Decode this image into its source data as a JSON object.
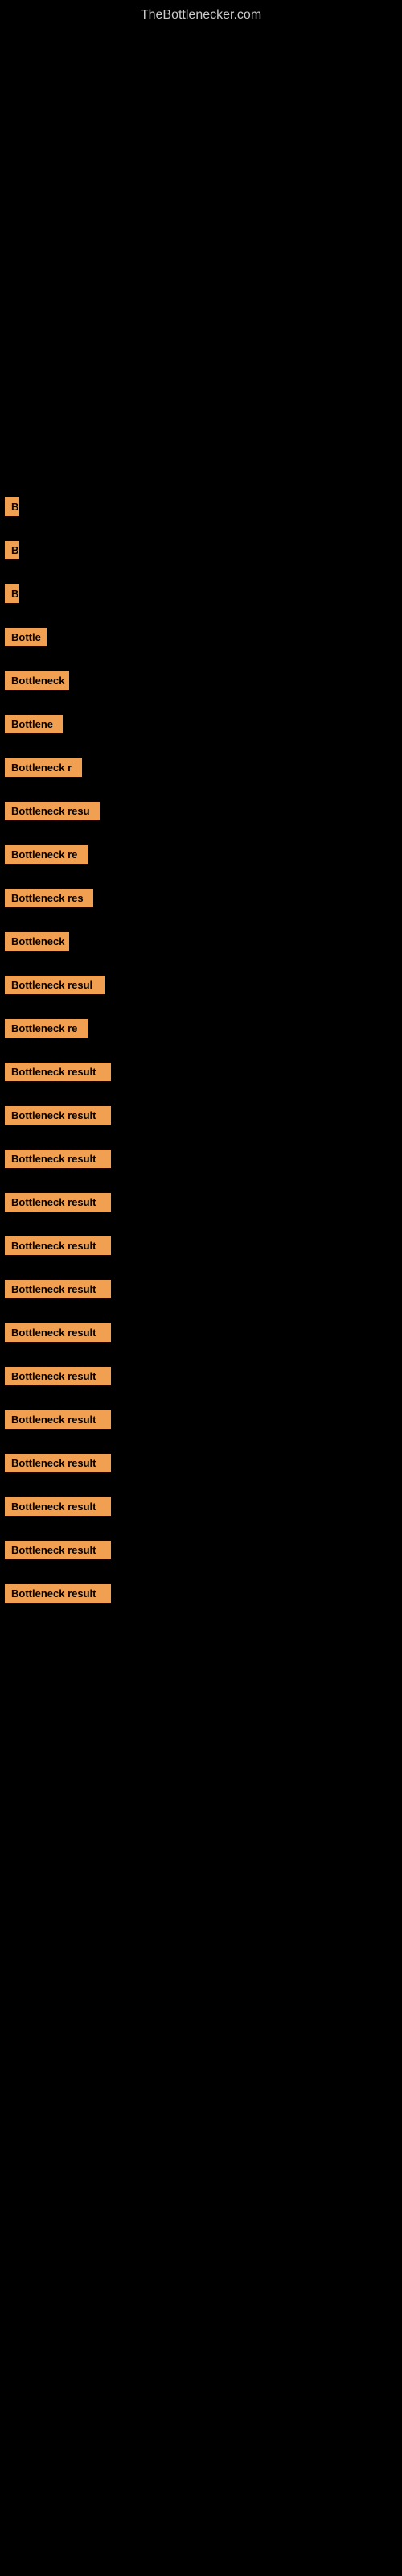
{
  "site": {
    "title": "TheBottlenecker.com"
  },
  "bars": [
    {
      "id": 1,
      "label": "B",
      "width": 18
    },
    {
      "id": 2,
      "label": "B",
      "width": 18
    },
    {
      "id": 3,
      "label": "B",
      "width": 18
    },
    {
      "id": 4,
      "label": "Bottle",
      "width": 52
    },
    {
      "id": 5,
      "label": "Bottleneck",
      "width": 80
    },
    {
      "id": 6,
      "label": "Bottlene",
      "width": 72
    },
    {
      "id": 7,
      "label": "Bottleneck r",
      "width": 96
    },
    {
      "id": 8,
      "label": "Bottleneck resu",
      "width": 118
    },
    {
      "id": 9,
      "label": "Bottleneck re",
      "width": 104
    },
    {
      "id": 10,
      "label": "Bottleneck res",
      "width": 110
    },
    {
      "id": 11,
      "label": "Bottleneck",
      "width": 80
    },
    {
      "id": 12,
      "label": "Bottleneck resul",
      "width": 124
    },
    {
      "id": 13,
      "label": "Bottleneck re",
      "width": 104
    },
    {
      "id": 14,
      "label": "Bottleneck result",
      "width": 132
    },
    {
      "id": 15,
      "label": "Bottleneck result",
      "width": 132
    },
    {
      "id": 16,
      "label": "Bottleneck result",
      "width": 132
    },
    {
      "id": 17,
      "label": "Bottleneck result",
      "width": 132
    },
    {
      "id": 18,
      "label": "Bottleneck result",
      "width": 132
    },
    {
      "id": 19,
      "label": "Bottleneck result",
      "width": 132
    },
    {
      "id": 20,
      "label": "Bottleneck result",
      "width": 132
    },
    {
      "id": 21,
      "label": "Bottleneck result",
      "width": 132
    },
    {
      "id": 22,
      "label": "Bottleneck result",
      "width": 132
    },
    {
      "id": 23,
      "label": "Bottleneck result",
      "width": 132
    },
    {
      "id": 24,
      "label": "Bottleneck result",
      "width": 132
    },
    {
      "id": 25,
      "label": "Bottleneck result",
      "width": 132
    },
    {
      "id": 26,
      "label": "Bottleneck result",
      "width": 132
    }
  ]
}
